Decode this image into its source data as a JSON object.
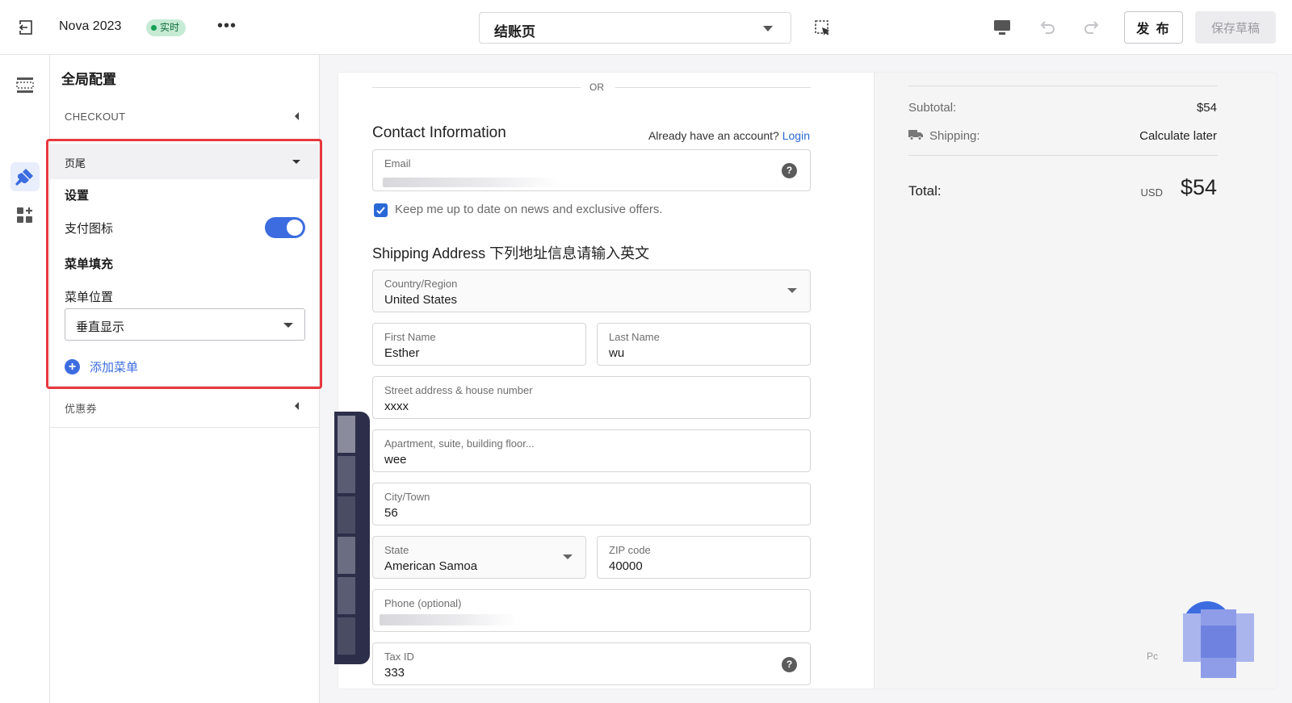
{
  "topbar": {
    "title": "Nova 2023",
    "badge": "实时",
    "page_select": "结账页",
    "publish": "发 布",
    "save_draft": "保存草稿"
  },
  "panel": {
    "title": "全局配置",
    "checkout_label": "CHECKOUT",
    "footer_label": "页尾",
    "settings": "设置",
    "payment_icons": "支付图标",
    "payment_icons_enabled": true,
    "menu_fill": "菜单填充",
    "menu_position": "菜单位置",
    "menu_position_value": "垂直显示",
    "add_menu": "添加菜单",
    "coupon_label": "优惠券"
  },
  "checkout": {
    "or": "OR",
    "contact_title": "Contact Information",
    "already_account": "Already have an account?",
    "login": "Login",
    "email_label": "Email",
    "news_optin": "Keep me up to date on news and exclusive offers.",
    "shipping_title": "Shipping Address 下列地址信息请输入英文",
    "fields": {
      "country": {
        "label": "Country/Region",
        "value": "United States"
      },
      "first_name": {
        "label": "First Name",
        "value": "Esther"
      },
      "last_name": {
        "label": "Last Name",
        "value": "wu"
      },
      "street": {
        "label": "Street address & house number",
        "value": "xxxx"
      },
      "apartment": {
        "label": "Apartment, suite, building floor...",
        "value": "wee"
      },
      "city": {
        "label": "City/Town",
        "value": "56"
      },
      "state": {
        "label": "State",
        "value": "American Samoa"
      },
      "zip": {
        "label": "ZIP code",
        "value": "40000"
      },
      "phone": {
        "label": "Phone (optional)",
        "value": ""
      },
      "tax": {
        "label": "Tax ID",
        "value": "333"
      }
    }
  },
  "summary": {
    "subtotal_label": "Subtotal:",
    "subtotal_value": "$54",
    "shipping_label": "Shipping:",
    "shipping_value": "Calculate later",
    "total_label": "Total:",
    "currency": "USD",
    "total_value": "$54",
    "cut_text": "Pc"
  },
  "colors": {
    "accent": "#3c6ce0",
    "highlight": "#e8383d",
    "badge_bg": "#c6ebd5",
    "link": "#2a68d6"
  }
}
